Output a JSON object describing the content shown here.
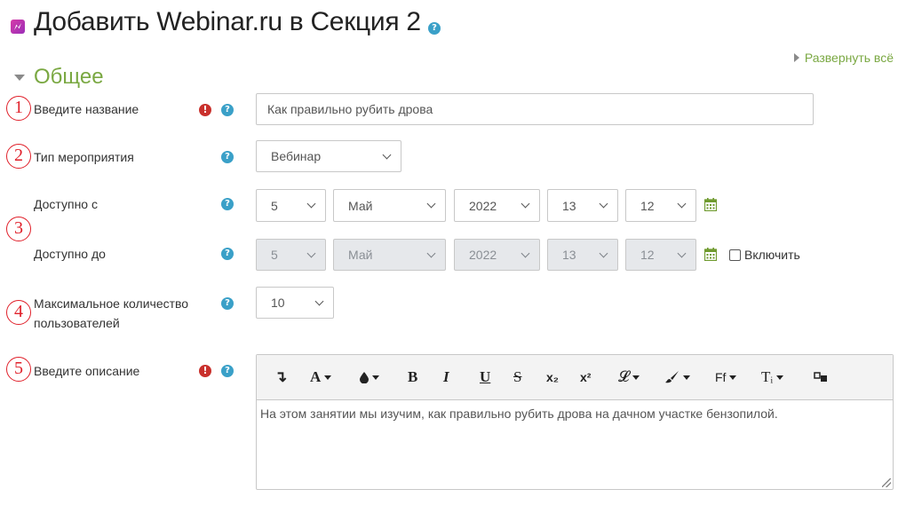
{
  "header": {
    "title": "Добавить Webinar.ru в Секция 2"
  },
  "expand_all": "Развернуть всё",
  "section": {
    "title": "Общее"
  },
  "badges": [
    "1",
    "2",
    "3",
    "4",
    "5"
  ],
  "fields": {
    "name": {
      "label": "Введите название",
      "value": "Как правильно рубить дрова"
    },
    "event_type": {
      "label": "Тип мероприятия",
      "value": "Вебинар"
    },
    "available_from": {
      "label": "Доступно с",
      "day": "5",
      "month": "Май",
      "year": "2022",
      "hour": "13",
      "minute": "12"
    },
    "available_to": {
      "label": "Доступно до",
      "day": "5",
      "month": "Май",
      "year": "2022",
      "hour": "13",
      "minute": "12",
      "enable_label": "Включить",
      "enabled": false
    },
    "max_users": {
      "label_line1": "Максимальное количество",
      "label_line2": "пользователей",
      "value": "10"
    },
    "description": {
      "label": "Введите описание",
      "value": "На этом занятии мы изучим, как правильно рубить дрова на дачном участке бензопилой."
    }
  },
  "toolbar": {
    "collapse": "↴",
    "font_color": "A",
    "bg_color": "💧",
    "bold": "B",
    "italic": "I",
    "underline": "U",
    "strike": "S",
    "sub": "x₂",
    "sup": "x²",
    "style": "𝓛",
    "brush": "🖌",
    "font_family": "Ff",
    "font_size": "Tᵢ",
    "media": "⧉"
  },
  "colors": {
    "accent": "#7aa842",
    "required": "#c9302c",
    "help": "#3aa0c8",
    "badge": "#e0202a"
  }
}
